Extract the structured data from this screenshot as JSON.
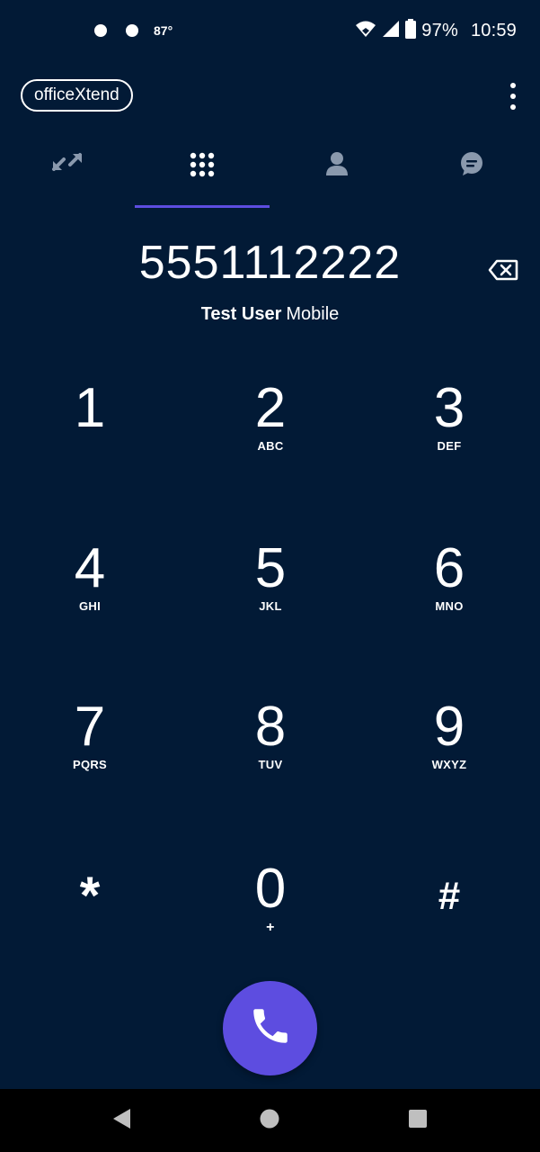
{
  "status_bar": {
    "temperature": "87°",
    "battery_percent": "97%",
    "time": "10:59"
  },
  "app_bar": {
    "brand": "officeXtend"
  },
  "tabs": [
    {
      "name": "recents",
      "icon": "call-history-icon",
      "selected": false
    },
    {
      "name": "dialpad",
      "icon": "dialpad-icon",
      "selected": true
    },
    {
      "name": "contacts",
      "icon": "person-icon",
      "selected": false
    },
    {
      "name": "messages",
      "icon": "chat-bubble-icon",
      "selected": false
    }
  ],
  "dialer": {
    "number": "5551112222",
    "caller_name": "Test User",
    "caller_type": "Mobile"
  },
  "keypad": [
    {
      "digit": "1",
      "letters": ""
    },
    {
      "digit": "2",
      "letters": "ABC"
    },
    {
      "digit": "3",
      "letters": "DEF"
    },
    {
      "digit": "4",
      "letters": "GHI"
    },
    {
      "digit": "5",
      "letters": "JKL"
    },
    {
      "digit": "6",
      "letters": "MNO"
    },
    {
      "digit": "7",
      "letters": "PQRS"
    },
    {
      "digit": "8",
      "letters": "TUV"
    },
    {
      "digit": "9",
      "letters": "WXYZ"
    },
    {
      "digit": "*",
      "letters": ""
    },
    {
      "digit": "0",
      "letters": "+"
    },
    {
      "digit": "#",
      "letters": ""
    }
  ],
  "colors": {
    "background": "#021a36",
    "accent": "#5d4de0",
    "inactive_icon": "#8a99ad",
    "nav_bar": "#000000"
  }
}
